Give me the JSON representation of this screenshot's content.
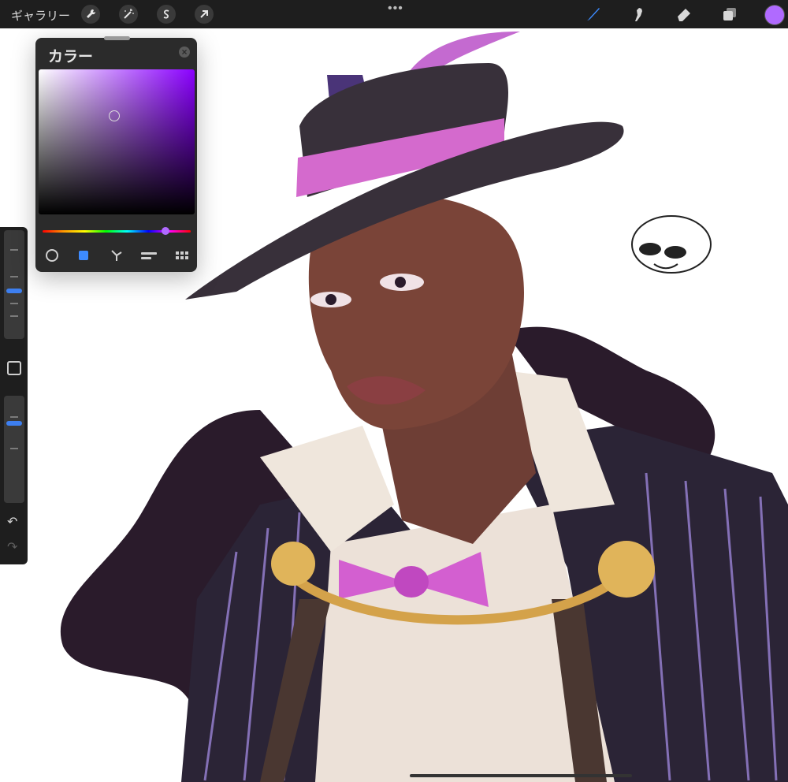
{
  "toolbar": {
    "gallery_label": "ギャラリー",
    "more": "•••",
    "current_color": "#b06aff",
    "left_tools": [
      "wrench-icon",
      "magic-wand-icon",
      "selection-icon",
      "move-arrow-icon"
    ],
    "right_tools": [
      "brush-icon",
      "smudge-icon",
      "eraser-icon",
      "layers-icon"
    ]
  },
  "color_panel": {
    "title": "カラー",
    "close": "×",
    "modes": [
      "disc-icon",
      "classic-icon",
      "harmony-icon",
      "value-icon",
      "palettes-icon"
    ],
    "active_mode": "classic-icon"
  },
  "sidebar": {
    "undo": "↶",
    "redo": "↷"
  }
}
